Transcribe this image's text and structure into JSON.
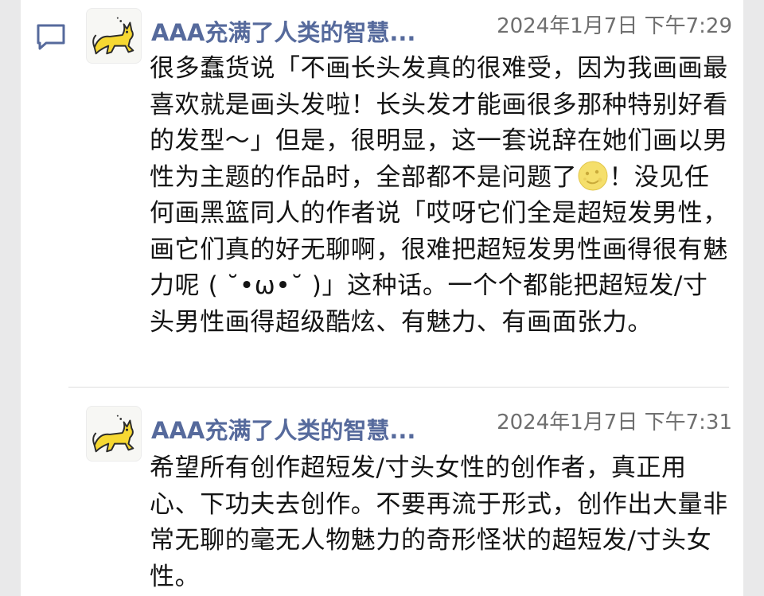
{
  "icons": {
    "comment": "comment-icon",
    "avatar": "yellow-cat-avatar",
    "emoji": "moon-face-emoji"
  },
  "colors": {
    "name": "#566a9c",
    "time": "#6f6f6f",
    "text": "#141414",
    "side": "#e9e9ea"
  },
  "messages": [
    {
      "author": "AAA充满了人类的智慧...",
      "time": "2024年1月7日 下午7:29",
      "text_before_emoji": "很多蠢货说「不画长头发真的很难受，因为我画画最喜欢就是画头发啦！长头发才能画很多那种特别好看的发型～」但是，很明显，这一套说辞在她们画以男性为主题的作品时，全部都不是问题了",
      "emoji": "🌝",
      "text_after_emoji": "！没见任何画黑篮同人的作者说「哎呀它们全是超短发男性，画它们真的好无聊啊，很难把超短发男性画得很有魅力呢 ( ˘•ω•˘ )」这种话。一个个都能把超短发/寸头男性画得超级酷炫、有魅力、有画面张力。"
    },
    {
      "author": "AAA充满了人类的智慧...",
      "time": "2024年1月7日 下午7:31",
      "text": "希望所有创作超短发/寸头女性的创作者，真正用心、下功夫去创作。不要再流于形式，创作出大量非常无聊的毫无人物魅力的奇形怪状的超短发/寸头女性。"
    }
  ]
}
